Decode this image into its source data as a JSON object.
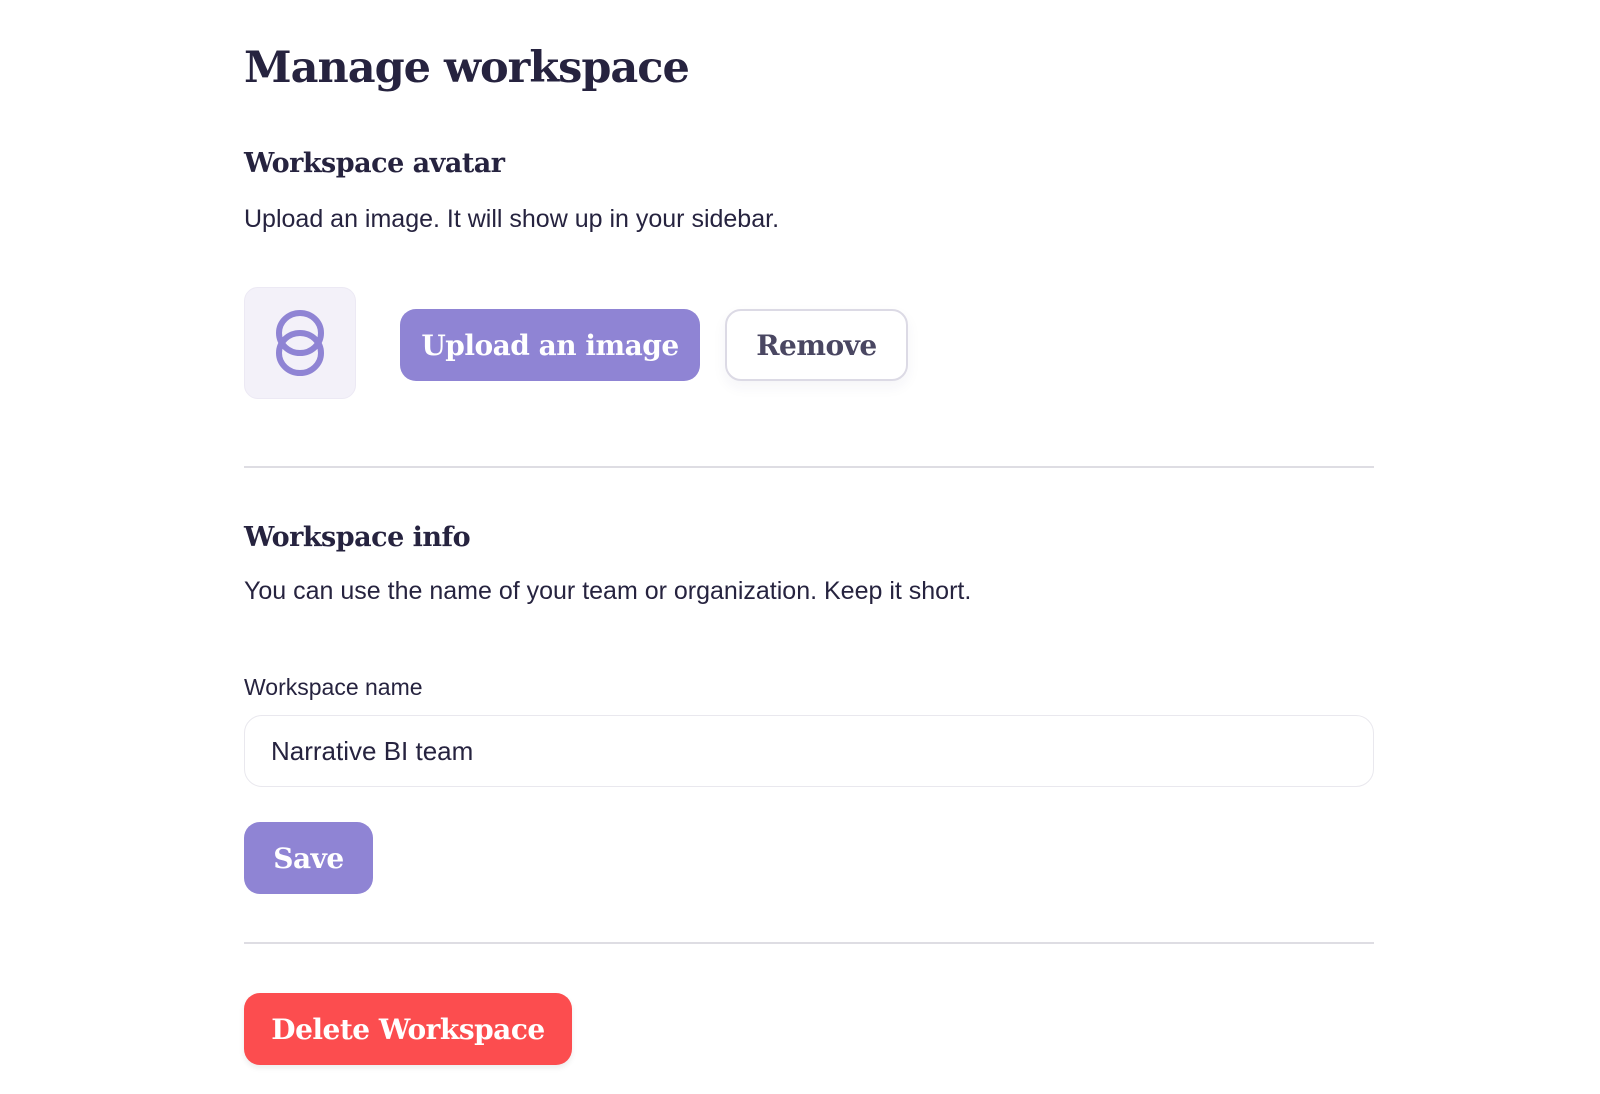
{
  "page": {
    "title": "Manage workspace"
  },
  "avatar_section": {
    "title": "Workspace avatar",
    "description": "Upload an image. It will show up in your sidebar.",
    "avatar_icon": "overlapping-rings-logo",
    "upload_label": "Upload an image",
    "remove_label": "Remove"
  },
  "info_section": {
    "title": "Workspace info",
    "description": "You can use the name of your team or organization. Keep it short.",
    "name_label": "Workspace name",
    "name_value": "Narrative BI team",
    "save_label": "Save"
  },
  "danger_zone": {
    "delete_label": "Delete Workspace"
  },
  "colors": {
    "primary": "#8f84d4",
    "danger": "#fc4d4f",
    "text": "#26233f",
    "avatar_bg": "#f3f1f9"
  }
}
